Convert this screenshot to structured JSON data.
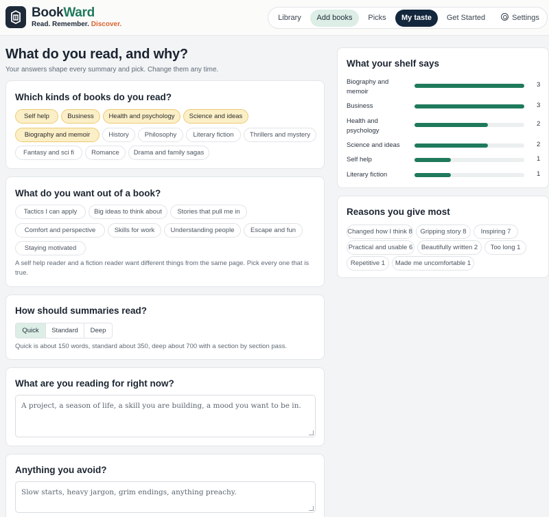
{
  "brand": {
    "name_a": "Book",
    "name_b": "Ward",
    "tag_a": "Read. Remember.",
    "tag_b": "Discover."
  },
  "nav": [
    {
      "label": "Library",
      "state": "default"
    },
    {
      "label": "Add books",
      "state": "soft"
    },
    {
      "label": "Picks",
      "state": "default"
    },
    {
      "label": "My taste",
      "state": "active"
    },
    {
      "label": "Get Started",
      "state": "default"
    },
    {
      "label": "Settings",
      "state": "default",
      "icon": "gear-icon"
    }
  ],
  "page": {
    "title": "What do you read, and why?",
    "subtitle": "Your answers shape every summary and pick. Change them any time."
  },
  "kinds": {
    "title": "Which kinds of books do you read?",
    "chips": [
      {
        "label": "Self help",
        "selected": true
      },
      {
        "label": "Business",
        "selected": true
      },
      {
        "label": "Health and psychology",
        "selected": true
      },
      {
        "label": "Science and ideas",
        "selected": true
      },
      {
        "label": "Biography and memoir",
        "selected": true
      },
      {
        "label": "History",
        "selected": false
      },
      {
        "label": "Philosophy",
        "selected": false
      },
      {
        "label": "Literary fiction",
        "selected": false
      },
      {
        "label": "Thrillers and mystery",
        "selected": false
      },
      {
        "label": "Fantasy and sci fi",
        "selected": false
      },
      {
        "label": "Romance",
        "selected": false
      },
      {
        "label": "Drama and family sagas",
        "selected": false
      }
    ]
  },
  "wants": {
    "title": "What do you want out of a book?",
    "chips": [
      {
        "label": "Tactics I can apply",
        "selected": false
      },
      {
        "label": "Big ideas to think about",
        "selected": false
      },
      {
        "label": "Stories that pull me in",
        "selected": false
      },
      {
        "label": "Comfort and perspective",
        "selected": false
      },
      {
        "label": "Skills for work",
        "selected": false
      },
      {
        "label": "Understanding people",
        "selected": false
      },
      {
        "label": "Escape and fun",
        "selected": false
      },
      {
        "label": "Staying motivated",
        "selected": false
      }
    ],
    "note": "A self help reader and a fiction reader want different things from the same page. Pick every one that is true."
  },
  "summaries": {
    "title": "How should summaries read?",
    "options": [
      {
        "label": "Quick",
        "selected": true
      },
      {
        "label": "Standard",
        "selected": false
      },
      {
        "label": "Deep",
        "selected": false
      }
    ],
    "note": "Quick is about 150 words, standard about 350, deep about 700 with a section by section pass."
  },
  "reading_now": {
    "title": "What are you reading for right now?",
    "placeholder": "A project, a season of life, a skill you are building, a mood you want to be in."
  },
  "avoid": {
    "title": "Anything you avoid?",
    "placeholder": "Slow starts, heavy jargon, grim endings, anything preachy."
  },
  "shelf": {
    "title": "What your shelf says",
    "max": 3,
    "bar_color": "#1f7a5c",
    "rows": [
      {
        "label": "Biography and memoir",
        "count": 3
      },
      {
        "label": "Business",
        "count": 3
      },
      {
        "label": "Health and psychology",
        "count": 2
      },
      {
        "label": "Science and ideas",
        "count": 2
      },
      {
        "label": "Self help",
        "count": 1
      },
      {
        "label": "Literary fiction",
        "count": 1
      }
    ]
  },
  "reasons": {
    "title": "Reasons you give most",
    "chips": [
      "Changed how I think 8",
      "Gripping story 8",
      "Inspiring 7",
      "Practical and usable 6",
      "Beautifully written 2",
      "Too long 1",
      "Repetitive 1",
      "Made me uncomfortable 1"
    ]
  },
  "colors": {
    "accent": "#1f7a5c",
    "selected_chip": "#fbefc7",
    "nav_active": "#13273d",
    "tagline_highlight": "#d9632f"
  }
}
